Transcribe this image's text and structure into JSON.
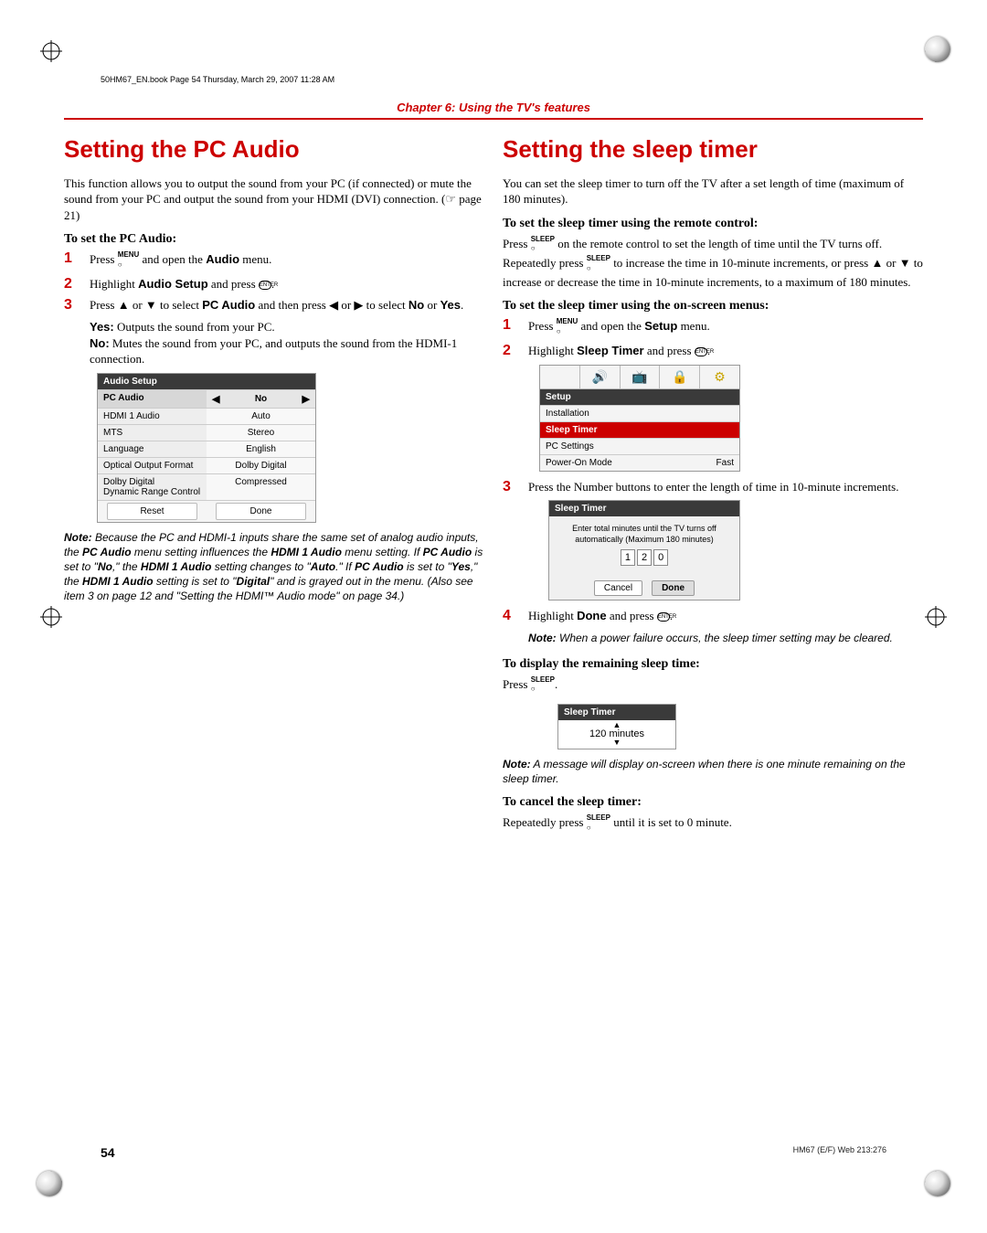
{
  "meta": {
    "header_note": "50HM67_EN.book  Page 54  Thursday, March 29, 2007  11:28 AM",
    "chapter": "Chapter 6: Using the TV's features",
    "page_number": "54",
    "foot_code": "HM67 (E/F) Web 213:276"
  },
  "left": {
    "title": "Setting the PC Audio",
    "intro": "This function allows you to output the sound from your PC (if connected) or mute the sound from your PC and output the sound from your HDMI (DVI) connection. (☞ page 21)",
    "subhead": "To set the PC Audio:",
    "step1_a": "Press ",
    "step1_icon": "MENU",
    "step1_b": " and open the ",
    "step1_bold": "Audio",
    "step1_c": " menu.",
    "step2_a": "Highlight ",
    "step2_bold": "Audio Setup",
    "step2_b": " and press ",
    "step2_c": ".",
    "step3_a": "Press ▲ or ▼ to select ",
    "step3_bold": "PC Audio",
    "step3_b": " and then press ◀ or ▶ to select ",
    "step3_no": "No",
    "step3_or": " or ",
    "step3_yes": "Yes",
    "step3_c": ".",
    "yes_lbl": "Yes:",
    "yes_txt": " Outputs the sound from your PC.",
    "no_lbl": "No:",
    "no_txt": " Mutes the sound from your PC, and outputs the sound from the HDMI-1 connection.",
    "osd": {
      "title": "Audio Setup",
      "rows": [
        {
          "label": "PC Audio",
          "value": "No",
          "selected": true,
          "arrows": true
        },
        {
          "label": "HDMI 1 Audio",
          "value": "Auto"
        },
        {
          "label": "MTS",
          "value": "Stereo"
        },
        {
          "label": "Language",
          "value": "English"
        },
        {
          "label": "Optical Output Format",
          "value": "Dolby Digital"
        },
        {
          "label": "Dolby Digital\nDynamic Range Control",
          "value": "Compressed"
        }
      ],
      "footer": {
        "reset": "Reset",
        "done": "Done"
      }
    },
    "note_lbl": "Note:",
    "note_body_a": " Because the PC and HDMI-1 inputs share the same set of analog audio inputs, the ",
    "note_b1": "PC Audio",
    "note_body_b": " menu setting influences the ",
    "note_b2": "HDMI 1 Audio",
    "note_body_c": " menu setting. If ",
    "note_b3": "PC Audio",
    "note_body_d": " is set to \"",
    "note_b4": "No",
    "note_body_e": ",\" the ",
    "note_b5": "HDMI 1 Audio",
    "note_body_f": " setting changes to \"",
    "note_b6": "Auto",
    "note_body_g": ".\" If ",
    "note_b7": "PC Audio",
    "note_body_h": " is set to \"",
    "note_b8": "Yes",
    "note_body_i": ",\" the ",
    "note_b9": "HDMI 1 Audio",
    "note_body_j": " setting is set to \"",
    "note_b10": "Digital",
    "note_body_k": "\" and is grayed out in the menu. (Also see item 3 on page 12 and \"Setting the HDMI™ Audio mode\" on page 34.)"
  },
  "right": {
    "title": "Setting the sleep timer",
    "intro": "You can set the sleep timer to turn off the TV after a set length of time (maximum of 180 minutes).",
    "sub1": "To set the sleep timer using the remote control:",
    "p1_a": "Press ",
    "p1_icon": "SLEEP",
    "p1_b": " on the remote control to set the length of time until the TV turns off. Repeatedly press ",
    "p1_c": " to increase the time in 10-minute increments, or press ▲ or ▼ to increase or decrease the time in 10-minute increments, to a maximum of 180 minutes.",
    "sub2": "To set the sleep timer using the on-screen menus:",
    "step1_a": "Press ",
    "step1_b": " and open the ",
    "step1_bold": "Setup",
    "step1_c": " menu.",
    "step2_a": "Highlight ",
    "step2_bold": "Sleep Timer",
    "step2_b": " and press ",
    "step2_c": ".",
    "setup_osd": {
      "title": "Setup",
      "rows": [
        {
          "label": "Installation",
          "value": ""
        },
        {
          "label": "Sleep Timer",
          "value": "",
          "sel": true
        },
        {
          "label": "PC Settings",
          "value": ""
        },
        {
          "label": "Power-On Mode",
          "value": "Fast"
        }
      ]
    },
    "step3": "Press the Number buttons to enter the length of time in 10-minute increments.",
    "sleep_osd": {
      "title": "Sleep Timer",
      "msg": "Enter total minutes until the TV turns off automatically (Maximum 180 minutes)",
      "d1": "1",
      "d2": "2",
      "d3": "0",
      "cancel": "Cancel",
      "done": "Done"
    },
    "step4_a": "Highlight ",
    "step4_bold": "Done",
    "step4_b": " and press ",
    "step4_c": ".",
    "note1_lbl": "Note:",
    "note1": " When a power failure occurs, the sleep timer setting may be cleared.",
    "sub3": "To display the remaining sleep time:",
    "p3_a": "Press ",
    "p3_b": ".",
    "mini": {
      "title": "Sleep Timer",
      "value": "120 minutes"
    },
    "note2_lbl": "Note:",
    "note2": " A message will display on-screen when there is one minute remaining on the sleep timer.",
    "sub4": "To cancel the sleep timer:",
    "p4_a": "Repeatedly press ",
    "p4_b": " until it is set to 0 minute."
  }
}
